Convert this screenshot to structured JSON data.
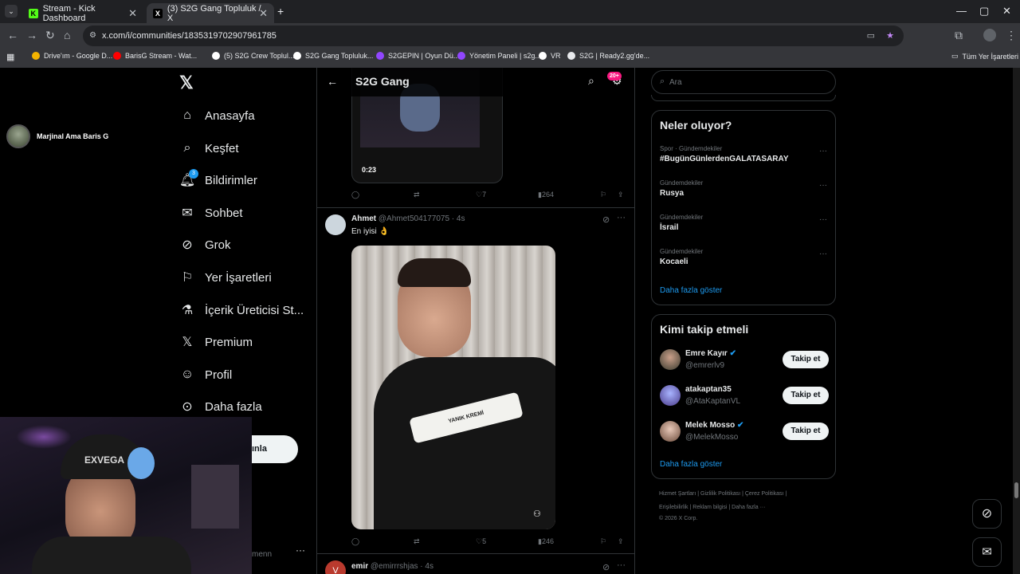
{
  "browser": {
    "tabs": [
      {
        "title": "Stream - Kick Dashboard",
        "favicon": "K"
      },
      {
        "title": "(3) S2G Gang Topluluk / X",
        "favicon": "X"
      }
    ],
    "url": "x.com/i/communities/1835319702907961785",
    "bookmarks": [
      "Drive'ım - Google D...",
      "BarisG Stream - Wat...",
      "(5) S2G Crew Toplul...",
      "S2G Gang Topluluk...",
      "S2GEPIN | Oyun Dü...",
      "Yönetim Paneli | s2g...",
      "VR",
      "S2G | Ready2.gg'de..."
    ],
    "all_bookmarks": "Tüm Yer İşaretleri"
  },
  "overlay": {
    "streamer_name": "Marjinal Ama Baris G",
    "cap_text": "EXVEGA",
    "post_button_fragment": "ınla",
    "account_fragment": "menn"
  },
  "nav": {
    "items": [
      "Anasayfa",
      "Keşfet",
      "Bildirimler",
      "Sohbet",
      "Grok",
      "Yer İşaretleri",
      "İçerik Üreticisi St...",
      "Premium",
      "Profil",
      "Daha fazla"
    ],
    "notif_count": "3"
  },
  "feed": {
    "title": "S2G Gang",
    "badge": "20+",
    "post1": {
      "video_time": "0:23",
      "likes": "7",
      "views": "264"
    },
    "post2": {
      "name": "Ahmet",
      "handle": "@Ahmet504177075",
      "time": "· 4s",
      "text": "En iyisi 👌",
      "product_label": "YANIK KREMİ",
      "likes": "5",
      "views": "246"
    },
    "post3": {
      "name": "emir",
      "handle": "@emirrrshjas",
      "time": "· 4s",
      "avatar_letter": "V"
    }
  },
  "right": {
    "search_placeholder": "Ara",
    "trending_title": "Neler oluyor?",
    "trends": [
      {
        "category": "Spor · Gündemdekiler",
        "name": "#BugünGünlerdenGALATASARAY"
      },
      {
        "category": "Gündemdekiler",
        "name": "Rusya"
      },
      {
        "category": "Gündemdekiler",
        "name": "İsrail"
      },
      {
        "category": "Gündemdekiler",
        "name": "Kocaeli"
      }
    ],
    "show_more": "Daha fazla göster",
    "who_title": "Kimi takip etmeli",
    "who": [
      {
        "name": "Emre Kayır",
        "handle": "@emrerlv9",
        "button": "Takip et"
      },
      {
        "name": "atakaptan35",
        "handle": "@AtaKaptanVL",
        "button": "Takip et"
      },
      {
        "name": "Melek Mosso",
        "handle": "@MelekMosso",
        "button": "Takip et"
      }
    ],
    "who_more": "Daha fazla göster",
    "footer_line1": "Hizmet Şartları  |  Gizlilik Politikası  |  Çerez Politikası  |",
    "footer_line2": "Erişilebilirlik  |  Reklam bilgisi  |  Daha fazla ···",
    "footer_line3": "© 2026 X Corp."
  },
  "colors": {
    "accent": "#1d9bf0",
    "badge": "#f91880",
    "bg": "#000000"
  }
}
